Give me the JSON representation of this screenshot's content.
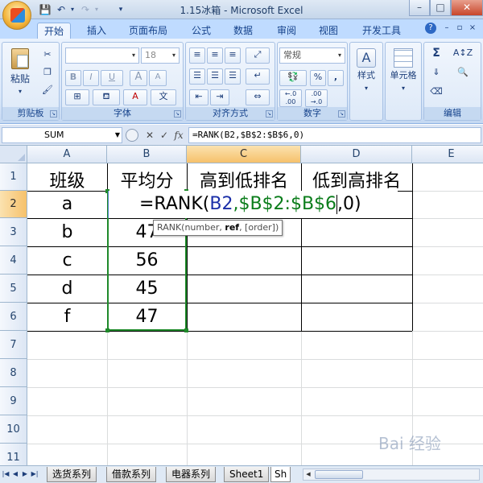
{
  "app": {
    "window_title": "1.15冰箱 - Microsoft Excel",
    "window_controls": {
      "minimize": "–",
      "maximize": "□",
      "close": "✕"
    }
  },
  "quick_access": {
    "save_icon": "💾",
    "undo_icon": "↶",
    "redo_icon": "↷",
    "customize_icon": "▾"
  },
  "tabs": [
    "开始",
    "插入",
    "页面布局",
    "公式",
    "数据",
    "审阅",
    "视图",
    "开发工具"
  ],
  "active_tab": "开始",
  "ribbon": {
    "clipboard": {
      "label": "剪贴板",
      "paste": "粘贴"
    },
    "font": {
      "label": "字体",
      "font_name": "",
      "font_size": "18",
      "bold": "B",
      "italic": "I",
      "underline": "U",
      "grow": "A",
      "shrink": "A",
      "phonetic": "文"
    },
    "alignment": {
      "label": "对齐方式"
    },
    "number": {
      "label": "数字",
      "format": "常规",
      "percent": "%",
      "comma": ",",
      "inc_dec": ".0\n.00",
      "dec_dec": ".00\n.0"
    },
    "styles": {
      "label": "样式"
    },
    "cells": {
      "label": "单元格"
    },
    "editing": {
      "label": "编辑",
      "sum": "Σ"
    }
  },
  "formula_bar": {
    "name_box": "SUM",
    "cancel": "✕",
    "enter": "✓",
    "fx": "fx",
    "formula": "=RANK(B2,$B$2:$B$6,0)"
  },
  "grid": {
    "columns": [
      "A",
      "B",
      "C",
      "D",
      "E"
    ],
    "rows": [
      "1",
      "2",
      "3",
      "4",
      "5",
      "6",
      "7",
      "8",
      "9",
      "10",
      "11"
    ],
    "header_row": {
      "A": "班级",
      "B": "平均分",
      "C": "高到低排名",
      "D": "低到高排名"
    },
    "data": [
      {
        "A": "a",
        "B": ""
      },
      {
        "A": "b",
        "B": "47"
      },
      {
        "A": "c",
        "B": "56"
      },
      {
        "A": "d",
        "B": "45"
      },
      {
        "A": "f",
        "B": "47"
      }
    ],
    "editing_cell": {
      "prefix": "=RANK(",
      "ref1": "B2",
      "comma1": ",",
      "ref2": "$B$2:$B$6",
      "suffix": ",0)"
    },
    "tooltip": {
      "fn": "RANK(number, ",
      "bold": "ref",
      "rest": ", [order])"
    }
  },
  "sheet_tabs": [
    "选货系列",
    "借款系列",
    "电器系列",
    "Sheet1",
    "Sh"
  ],
  "watermark": "Bai 经验"
}
